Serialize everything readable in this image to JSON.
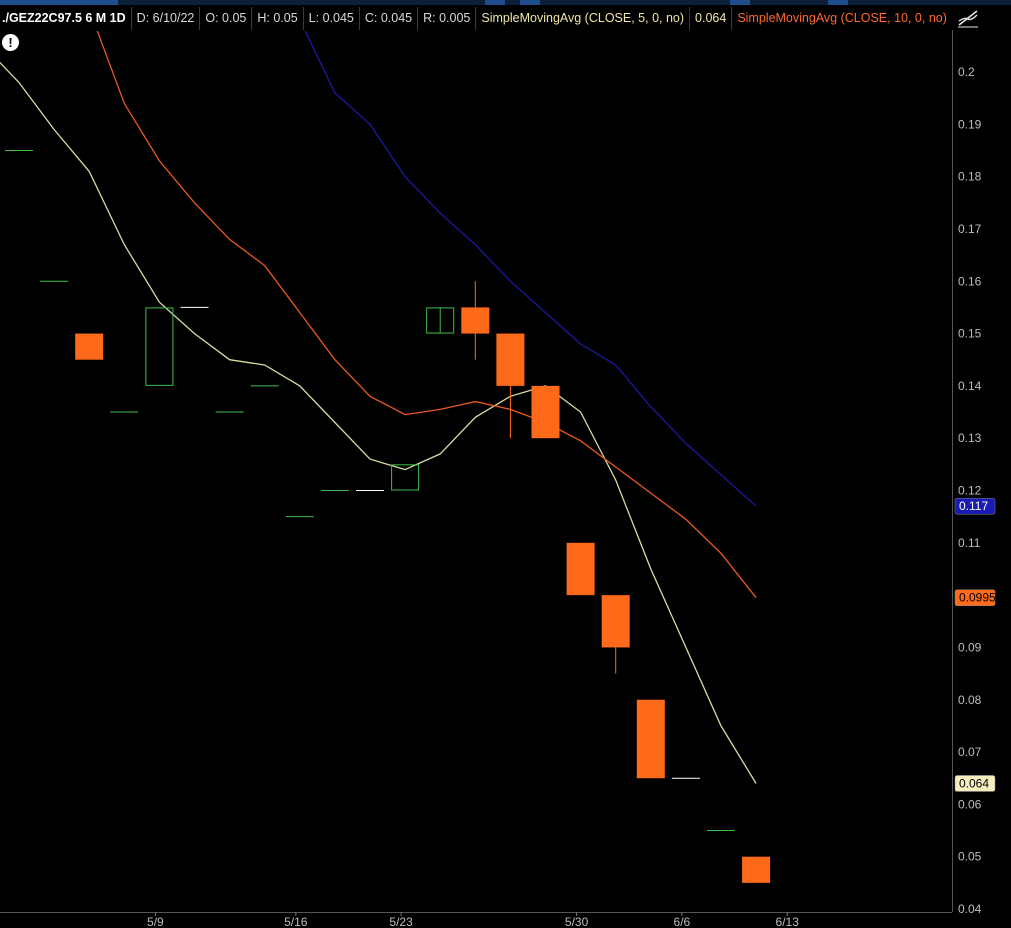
{
  "header": {
    "symbol": "./GEZ22C97.5 6 M 1D",
    "date": "D: 6/10/22",
    "open": "O: 0.05",
    "high": "H: 0.05",
    "low": "L: 0.045",
    "close": "C: 0.045",
    "range": "R: 0.005",
    "sma5_label": "SimpleMovingAvg (CLOSE, 5, 0, no)",
    "sma5_value": "0.064",
    "sma10_label": "SimpleMovingAvg (CLOSE, 10, 0, no)",
    "more": "..."
  },
  "colors": {
    "up": "#3fbf4a",
    "down": "#ff6a1a",
    "sma5": "#d8dca0",
    "sma10": "#e85a20",
    "sma20": "#1a1aa0"
  },
  "chart_data": {
    "type": "candlestick",
    "ylim": [
      0.04,
      0.205
    ],
    "yticks": [
      "0.2",
      "0.19",
      "0.18",
      "0.17",
      "0.16",
      "0.15",
      "0.14",
      "0.13",
      "0.12",
      "0.11",
      "0.1",
      "0.09",
      "0.08",
      "0.07",
      "0.06",
      "0.05",
      "0.04"
    ],
    "ytick_values": [
      0.2,
      0.19,
      0.18,
      0.17,
      0.16,
      0.15,
      0.14,
      0.13,
      0.12,
      0.11,
      0.1,
      0.09,
      0.08,
      0.07,
      0.06,
      0.05,
      0.04
    ],
    "xticks": [
      {
        "label": "5/9",
        "index": 4
      },
      {
        "label": "5/16",
        "index": 8
      },
      {
        "label": "5/23",
        "index": 11
      },
      {
        "label": "5/30",
        "index": 16
      },
      {
        "label": "6/6",
        "index": 19
      },
      {
        "label": "6/13",
        "index": 22
      }
    ],
    "candles": [
      {
        "o": 0.185,
        "h": 0.185,
        "l": 0.185,
        "c": 0.185
      },
      {
        "o": 0.16,
        "h": 0.16,
        "l": 0.16,
        "c": 0.16
      },
      {
        "o": 0.15,
        "h": 0.15,
        "l": 0.145,
        "c": 0.145
      },
      {
        "o": 0.135,
        "h": 0.135,
        "l": 0.135,
        "c": 0.135
      },
      {
        "o": 0.14,
        "h": 0.155,
        "l": 0.14,
        "c": 0.155
      },
      {
        "o": 0.155,
        "h": 0.155,
        "l": 0.155,
        "c": 0.155
      },
      {
        "o": 0.135,
        "h": 0.135,
        "l": 0.135,
        "c": 0.135
      },
      {
        "o": 0.14,
        "h": 0.14,
        "l": 0.14,
        "c": 0.14
      },
      {
        "o": 0.115,
        "h": 0.115,
        "l": 0.115,
        "c": 0.115
      },
      {
        "o": 0.12,
        "h": 0.12,
        "l": 0.12,
        "c": 0.12
      },
      {
        "o": 0.12,
        "h": 0.12,
        "l": 0.12,
        "c": 0.12
      },
      {
        "o": 0.12,
        "h": 0.125,
        "l": 0.12,
        "c": 0.125
      },
      {
        "o": 0.15,
        "h": 0.155,
        "l": 0.15,
        "c": 0.155
      },
      {
        "o": 0.155,
        "h": 0.16,
        "l": 0.145,
        "c": 0.15
      },
      {
        "o": 0.15,
        "h": 0.15,
        "l": 0.13,
        "c": 0.14
      },
      {
        "o": 0.14,
        "h": 0.14,
        "l": 0.13,
        "c": 0.13
      },
      {
        "o": 0.11,
        "h": 0.11,
        "l": 0.1,
        "c": 0.1
      },
      {
        "o": 0.1,
        "h": 0.1,
        "l": 0.085,
        "c": 0.09
      },
      {
        "o": 0.08,
        "h": 0.08,
        "l": 0.065,
        "c": 0.065
      },
      {
        "o": 0.065,
        "h": 0.065,
        "l": 0.065,
        "c": 0.065
      },
      {
        "o": 0.055,
        "h": 0.055,
        "l": 0.055,
        "c": 0.055
      },
      {
        "o": 0.05,
        "h": 0.05,
        "l": 0.045,
        "c": 0.045
      }
    ],
    "hollow_up_indices": [
      4,
      11,
      12
    ],
    "series": [
      {
        "name": "SimpleMovingAvg (CLOSE, 5, 0, no)",
        "color": "#d8dca0",
        "label": "0.064",
        "start_value": 0.205,
        "values": [
          0.198,
          0.189,
          0.181,
          0.167,
          0.156,
          0.15,
          0.145,
          0.144,
          0.14,
          0.133,
          0.126,
          0.124,
          0.127,
          0.134,
          0.138,
          0.14,
          0.135,
          0.122,
          0.105,
          0.09,
          0.075,
          0.064
        ]
      },
      {
        "name": "SimpleMovingAvg (CLOSE, 10, 0, no)",
        "color": "#e85a20",
        "label": "0.0995",
        "start_value": 0.223,
        "values": [
          0.212,
          0.194,
          0.183,
          0.175,
          0.168,
          0.163,
          0.154,
          0.145,
          0.138,
          0.1345,
          0.1355,
          0.137,
          0.1355,
          0.133,
          0.1295,
          0.1245,
          0.1195,
          0.1145,
          0.108,
          0.0995
        ]
      },
      {
        "name": "SimpleMovingAvg (CLOSE, 20, 0, no)",
        "color": "#1a1aa0",
        "label": "0.117",
        "start_value": 0.21,
        "values": [
          0.196,
          0.19,
          0.18,
          0.173,
          0.167,
          0.16,
          0.154,
          0.148,
          0.144,
          0.136,
          0.129,
          0.123,
          0.117
        ]
      }
    ],
    "price_labels": [
      {
        "value": "0.117",
        "bg": "#1a1ab4",
        "fg": "#ffffff",
        "at": 0.117
      },
      {
        "value": "0.0995",
        "bg": "#ff6a1a",
        "fg": "#000000",
        "at": 0.0995
      },
      {
        "value": "0.064",
        "bg": "#f5efc0",
        "fg": "#000000",
        "at": 0.064
      }
    ]
  }
}
